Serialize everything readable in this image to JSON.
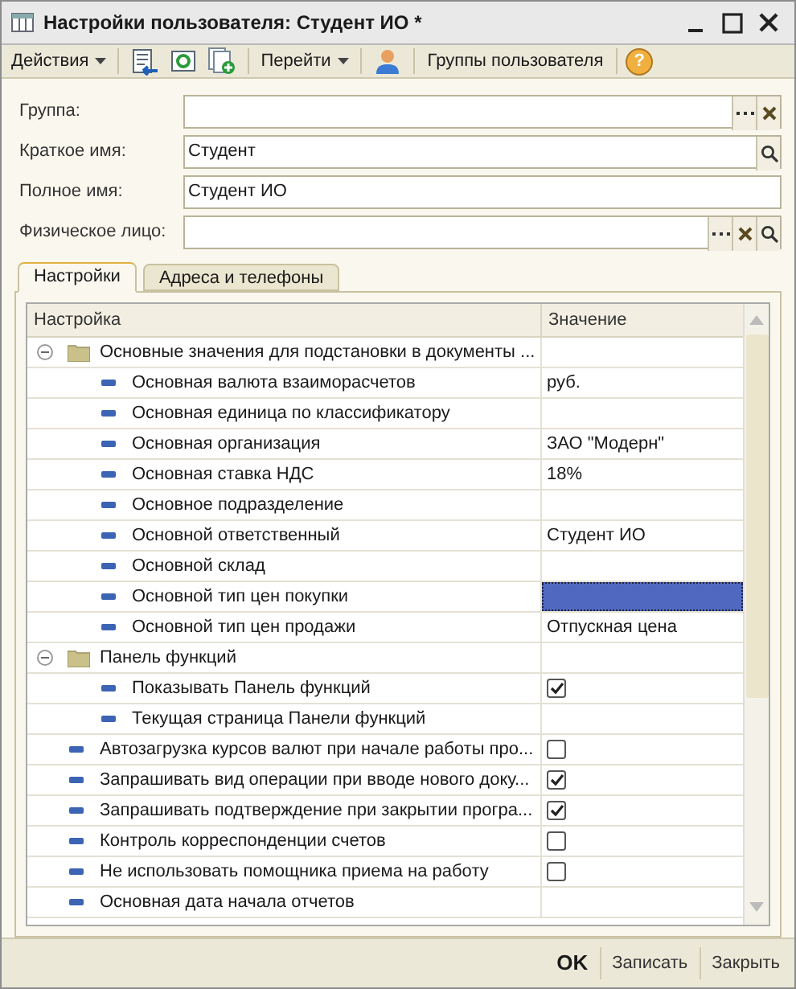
{
  "window": {
    "title": "Настройки пользователя: Студент ИО *"
  },
  "toolbar": {
    "items": [
      {
        "kind": "menu",
        "label": "Действия"
      },
      {
        "kind": "icon"
      },
      {
        "kind": "icon"
      },
      {
        "kind": "icon"
      },
      {
        "kind": "menu",
        "label": "Перейти"
      },
      {
        "kind": "icon"
      },
      {
        "kind": "button",
        "label": "Группы пользователя"
      },
      {
        "kind": "help",
        "label": "?"
      }
    ]
  },
  "fields": [
    {
      "label": "Группа:",
      "kind": "reference"
    },
    {
      "label": "Краткое имя:",
      "value": "Студент",
      "kind": "search"
    },
    {
      "label": "Полное имя:",
      "value": "Студент ИО",
      "kind": "plain"
    },
    {
      "label": "Физическое лицо:",
      "kind": "reference-search"
    }
  ],
  "tabs": [
    {
      "label": "Настройки",
      "selected": true
    },
    {
      "label": "Адреса и телефоны",
      "selected": false
    }
  ],
  "table": {
    "columns": [
      "Настройка",
      "Значение"
    ],
    "rows": [
      {
        "kind": "group",
        "name": "Основные значения для подстановки в документы ...",
        "expanded": true,
        "children": [
          {
            "kind": "value",
            "name": "Основная валюта взаиморасчетов",
            "value": "руб.",
            "selected": false
          },
          {
            "kind": "value",
            "name": "Основная единица по классификатору",
            "selected": false
          },
          {
            "kind": "value",
            "name": "Основная организация",
            "value": "ЗАО \"Модерн\"",
            "selected": false
          },
          {
            "kind": "value",
            "name": "Основная ставка НДС",
            "value": "18%",
            "selected": false
          },
          {
            "kind": "value",
            "name": "Основное подразделение",
            "selected": false
          },
          {
            "kind": "value",
            "name": "Основной ответственный",
            "value": "Студент ИО",
            "selected": false
          },
          {
            "kind": "value",
            "name": "Основной склад",
            "selected": false
          },
          {
            "kind": "value",
            "name": "Основной тип цен покупки",
            "selected": true
          },
          {
            "kind": "value",
            "name": "Основной тип цен продажи",
            "value": "Отпускная цена",
            "selected": false
          }
        ]
      },
      {
        "kind": "group",
        "name": "Панель функций",
        "expanded": true,
        "children": [
          {
            "kind": "check",
            "name": "Показывать Панель функций",
            "checked": true,
            "selected": false
          },
          {
            "kind": "value",
            "name": "Текущая страница Панели функций",
            "selected": false
          }
        ]
      },
      {
        "kind": "check",
        "name": "Автозагрузка курсов валют при начале работы про...",
        "checked": false,
        "selected": false
      },
      {
        "kind": "check",
        "name": "Запрашивать вид операции при вводе нового доку...",
        "checked": true,
        "selected": false
      },
      {
        "kind": "check",
        "name": "Запрашивать подтверждение при закрытии програ...",
        "checked": true,
        "selected": false
      },
      {
        "kind": "check",
        "name": "Контроль корреспонденции счетов",
        "checked": false,
        "selected": false
      },
      {
        "kind": "check",
        "name": "Не использовать помощника приема на работу",
        "checked": false,
        "selected": false
      },
      {
        "kind": "value",
        "name": "Основная дата начала отчетов",
        "selected": false
      }
    ]
  },
  "footer": {
    "buttons": [
      {
        "label": "OK",
        "kind": "default"
      },
      {
        "label": "Записать",
        "kind": "normal"
      },
      {
        "label": "Закрыть",
        "kind": "normal"
      }
    ]
  }
}
